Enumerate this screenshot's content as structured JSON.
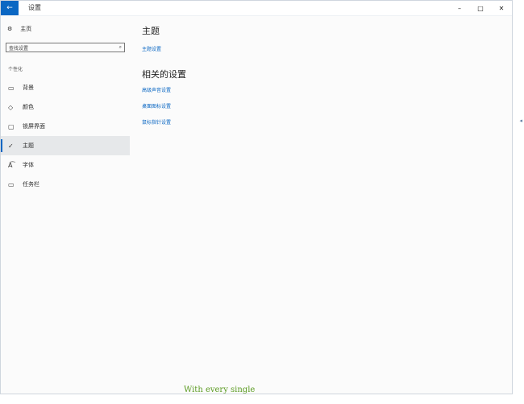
{
  "window": {
    "back_glyph": "←",
    "title": "设置",
    "controls": {
      "minimize": "–",
      "maximize": "□",
      "close": "✕"
    }
  },
  "sidebar": {
    "home": {
      "icon": "gear-icon",
      "glyph": "⚙",
      "label": "主页"
    },
    "search": {
      "placeholder": "查找设置",
      "icon": "search-icon",
      "glyph": "⌕"
    },
    "section_label": "个性化",
    "items": [
      {
        "name": "background",
        "icon": "picture-icon",
        "glyph": "▭",
        "label": "背景",
        "active": false
      },
      {
        "name": "colors",
        "icon": "palette-icon",
        "glyph": "◇",
        "label": "颜色",
        "active": false
      },
      {
        "name": "lockscreen",
        "icon": "lock-screen-icon",
        "glyph": "▢",
        "label": "锁屏界面",
        "active": false
      },
      {
        "name": "themes",
        "icon": "brush-icon",
        "glyph": "✓",
        "label": "主题",
        "active": true
      },
      {
        "name": "fonts",
        "icon": "font-icon",
        "glyph": "A͡",
        "label": "字体",
        "active": false
      },
      {
        "name": "taskbar",
        "icon": "taskbar-icon",
        "glyph": "▭",
        "label": "任务栏",
        "active": false
      }
    ]
  },
  "main": {
    "title": "主题",
    "theme_settings_link": "主题设置",
    "related_title": "相关的设置",
    "related_links": [
      "高级声音设置",
      "桌面图标设置",
      "鼠标指针设置"
    ]
  },
  "caption": "With every single",
  "edge_glyph": "◂",
  "colors": {
    "accent": "#0a67c3",
    "caption": "#5a9a20"
  }
}
